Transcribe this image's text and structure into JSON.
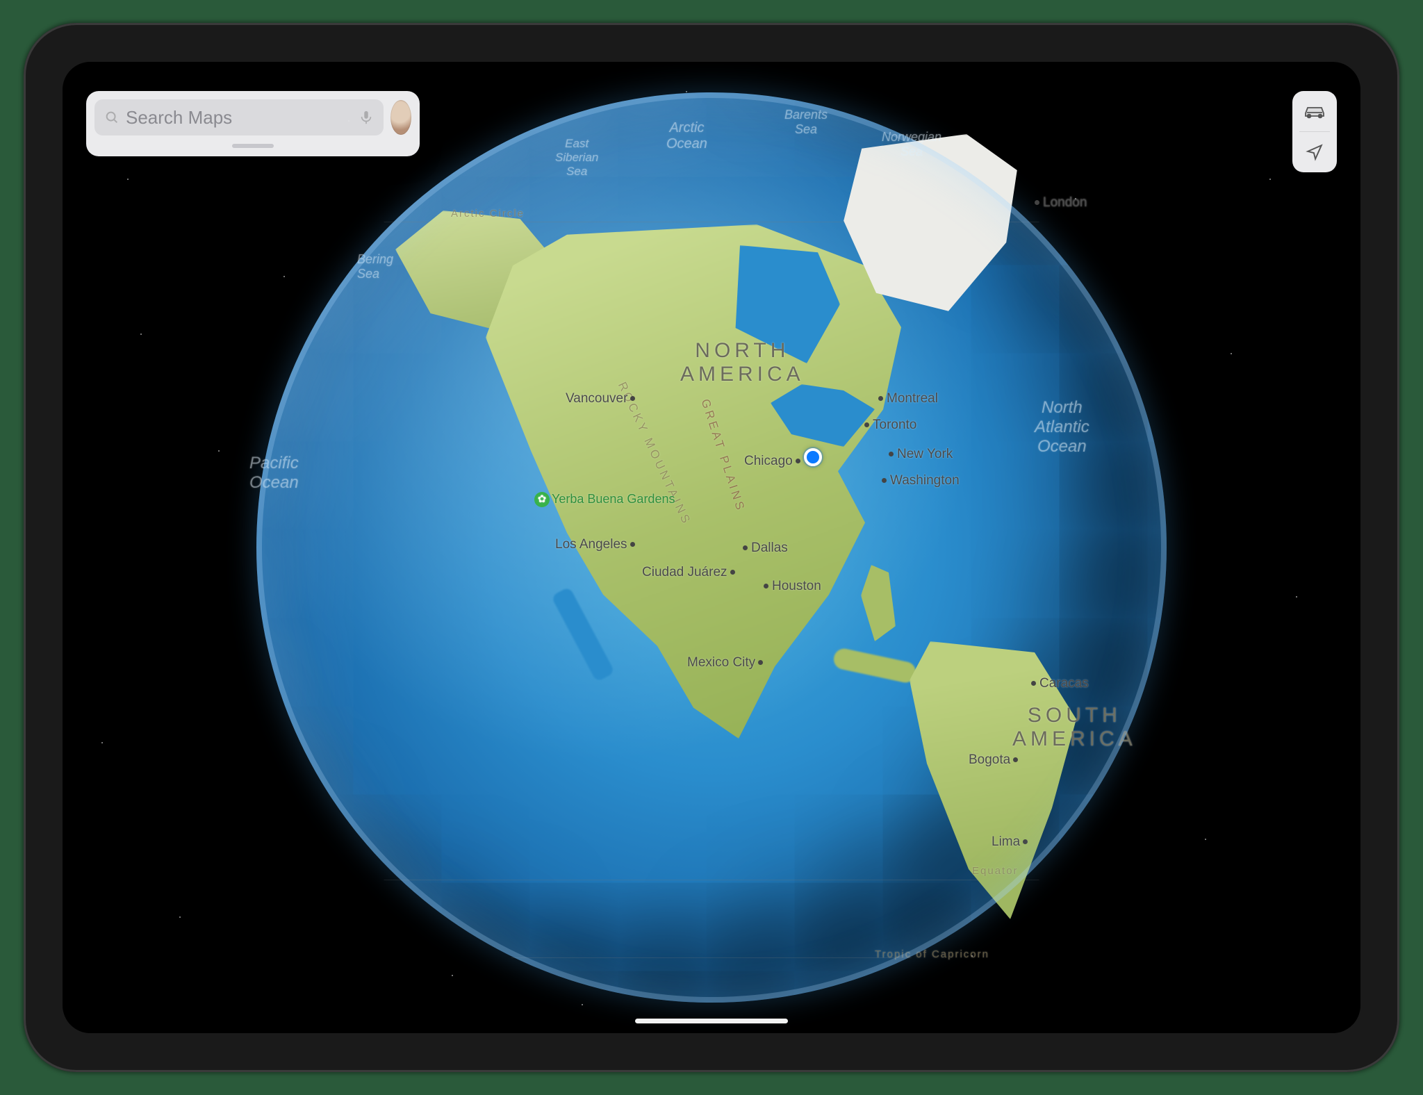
{
  "search": {
    "placeholder": "Search Maps"
  },
  "globe": {
    "continents": {
      "na_line1": "NORTH",
      "na_line2": "AMERICA",
      "sa_line1": "SOUTH",
      "sa_line2": "AMERICA"
    },
    "oceans": {
      "pacific": "Pacific\nOcean",
      "atlantic": "North\nAtlantic\nOcean",
      "arctic": "Arctic\nOcean",
      "barents": "Barents\nSea",
      "norwegian": "Norwegian\nSea",
      "bering": "Bering\nSea",
      "east_siberian": "East\nSiberian\nSea"
    },
    "features": {
      "rocky": "ROCKY MOUNTAINS",
      "great_plains": "GREAT PLAINS",
      "arctic_circle": "Arctic Circle",
      "equator": "Equator",
      "capricorn": "Tropic of Capricorn"
    },
    "cities": {
      "vancouver": "Vancouver",
      "montreal": "Montreal",
      "toronto": "Toronto",
      "chicago": "Chicago",
      "new_york": "New York",
      "washington": "Washington",
      "los_angeles": "Los Angeles",
      "dallas": "Dallas",
      "houston": "Houston",
      "ciudad_juarez": "Ciudad Juárez",
      "mexico_city": "Mexico City",
      "bogota": "Bogota",
      "caracas": "Caracas",
      "lima": "Lima",
      "london": "London"
    },
    "poi": {
      "yerba_buena": "Yerba Buena Gardens"
    }
  },
  "controls": {
    "mode": "Driving",
    "locate": "Current Location"
  },
  "colors": {
    "accent": "#0a7aff",
    "land": "#b4cc7a",
    "ocean": "#2a8dcd"
  }
}
